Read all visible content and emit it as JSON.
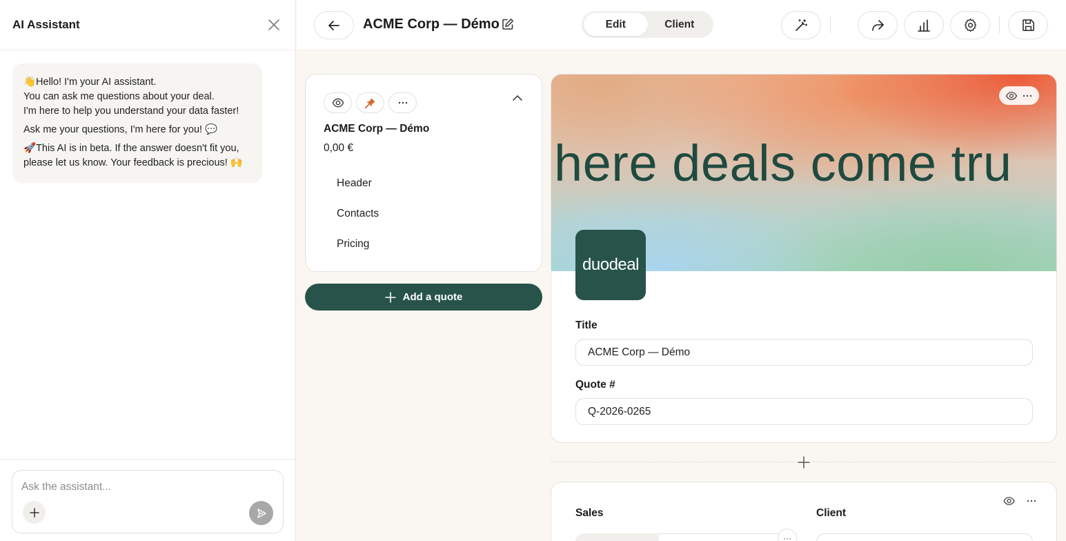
{
  "ai": {
    "title": "AI Assistant",
    "message": {
      "line1": "👋Hello! I'm your AI assistant.",
      "line2": "You can ask me questions about your deal.",
      "line3": "I'm here to help you understand your data faster!",
      "line4": "Ask me your questions, I'm here for you! 💬",
      "line5": "🚀This AI is in beta. If the answer doesn't fit you,",
      "line6": "please let us know. Your feedback is precious! 🙌"
    },
    "input_placeholder": "Ask the assistant..."
  },
  "topbar": {
    "doc_title": "ACME Corp — Démo",
    "modes": {
      "edit": "Edit",
      "client": "Client"
    },
    "active_mode": "edit"
  },
  "outline": {
    "title": "ACME Corp — Démo",
    "price": "0,00 €",
    "sections": [
      "Header",
      "Contacts",
      "Pricing"
    ],
    "add_quote_label": "Add a quote"
  },
  "header_block": {
    "banner_text": "here deals come tru",
    "logo_text": "duodeal",
    "title_label": "Title",
    "title_value": "ACME Corp — Démo",
    "quote_label": "Quote #",
    "quote_value": "Q-2026-0265"
  },
  "contacts_block": {
    "sales_label": "Sales",
    "client_label": "Client"
  },
  "colors": {
    "brand_green": "#27534a",
    "background": "#faf7f3",
    "pin_orange": "#d9682b"
  }
}
